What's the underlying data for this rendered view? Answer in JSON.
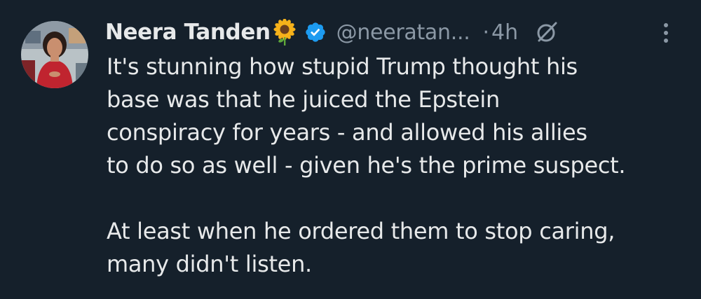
{
  "tweet": {
    "author_name": "Neera Tanden",
    "author_emoji_icon": "sunflower-icon",
    "verified_icon": "verified-badge-icon",
    "handle": "@neeratan...",
    "separator": "·",
    "time": "4h",
    "grok_icon": "grok-icon",
    "more_icon": "more-vertical-icon",
    "text_lines_p1": [
      "It's stunning how stupid Trump thought his",
      "base was that he juiced the Epstein",
      "conspiracy for years - and allowed his allies",
      "to do so as well - given he's the prime suspect."
    ],
    "text_lines_p2": [
      "At least when he ordered them to stop caring,",
      "many didn't listen."
    ]
  },
  "colors": {
    "background": "#15202b",
    "text_primary": "#e7e9ea",
    "text_secondary": "#8b98a5",
    "verified_blue": "#1d9bf0"
  }
}
